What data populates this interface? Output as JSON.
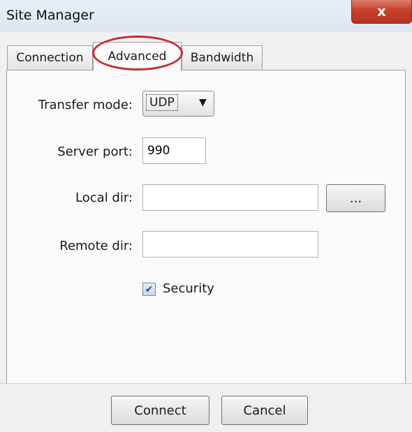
{
  "window": {
    "title": "Site Manager",
    "close_glyph": "x"
  },
  "tabs": [
    {
      "label": "Connection",
      "active": false
    },
    {
      "label": "Advanced",
      "active": true
    },
    {
      "label": "Bandwidth",
      "active": false
    }
  ],
  "form": {
    "transfer_mode": {
      "label": "Transfer mode:",
      "value": "UDP",
      "icon": "chevron-down-icon"
    },
    "server_port": {
      "label": "Server port:",
      "value": "990"
    },
    "local_dir": {
      "label": "Local dir:",
      "value": "",
      "browse_label": "..."
    },
    "remote_dir": {
      "label": "Remote dir:",
      "value": ""
    },
    "security": {
      "label": "Security",
      "checked": true
    }
  },
  "buttons": {
    "connect": "Connect",
    "cancel": "Cancel"
  },
  "colors": {
    "highlight_circle": "#c42d33",
    "close_button": "#c8432d"
  }
}
